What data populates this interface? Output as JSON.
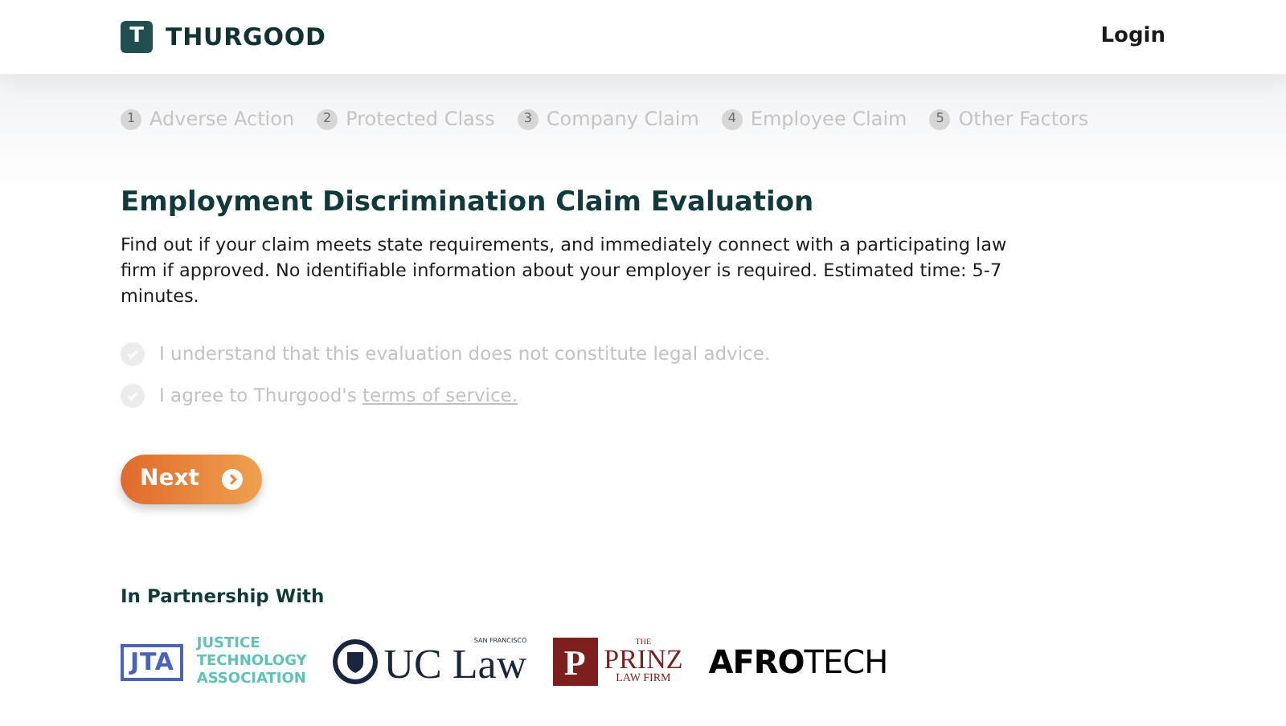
{
  "header": {
    "brand": "THURGOOD",
    "brand_mark": "T",
    "login": "Login"
  },
  "steps": [
    {
      "number": "1",
      "label": "Adverse Action"
    },
    {
      "number": "2",
      "label": "Protected Class"
    },
    {
      "number": "3",
      "label": "Company Claim"
    },
    {
      "number": "4",
      "label": "Employee Claim"
    },
    {
      "number": "5",
      "label": "Other Factors"
    }
  ],
  "title": "Employment Discrimination Claim Evaluation",
  "description": "Find out if your claim meets state requirements, and immediately connect with a participating law firm if approved. No identifiable information about your employer is required. Estimated time: 5-7 minutes.",
  "agreements": [
    {
      "text": "I understand that this evaluation does not constitute legal advice.",
      "checked": false
    },
    {
      "text": "I agree to Thurgood's",
      "link": "terms of service.",
      "checked": false
    }
  ],
  "next_button": "Next",
  "partners": {
    "heading": "In Partnership With",
    "logos": [
      {
        "kind": "jta",
        "mark": "JTA",
        "lines": [
          "JUSTICE",
          "TECHNOLOGY",
          "ASSOCIATION"
        ]
      },
      {
        "kind": "uclaw",
        "small": "SAN FRANCISCO",
        "name": "UC Law"
      },
      {
        "kind": "prinz",
        "mark": "P",
        "lines": [
          "THE",
          "PRINZ",
          "LAW FIRM"
        ]
      },
      {
        "kind": "afrotech",
        "name": "**AFRO**TECH"
      }
    ]
  }
}
